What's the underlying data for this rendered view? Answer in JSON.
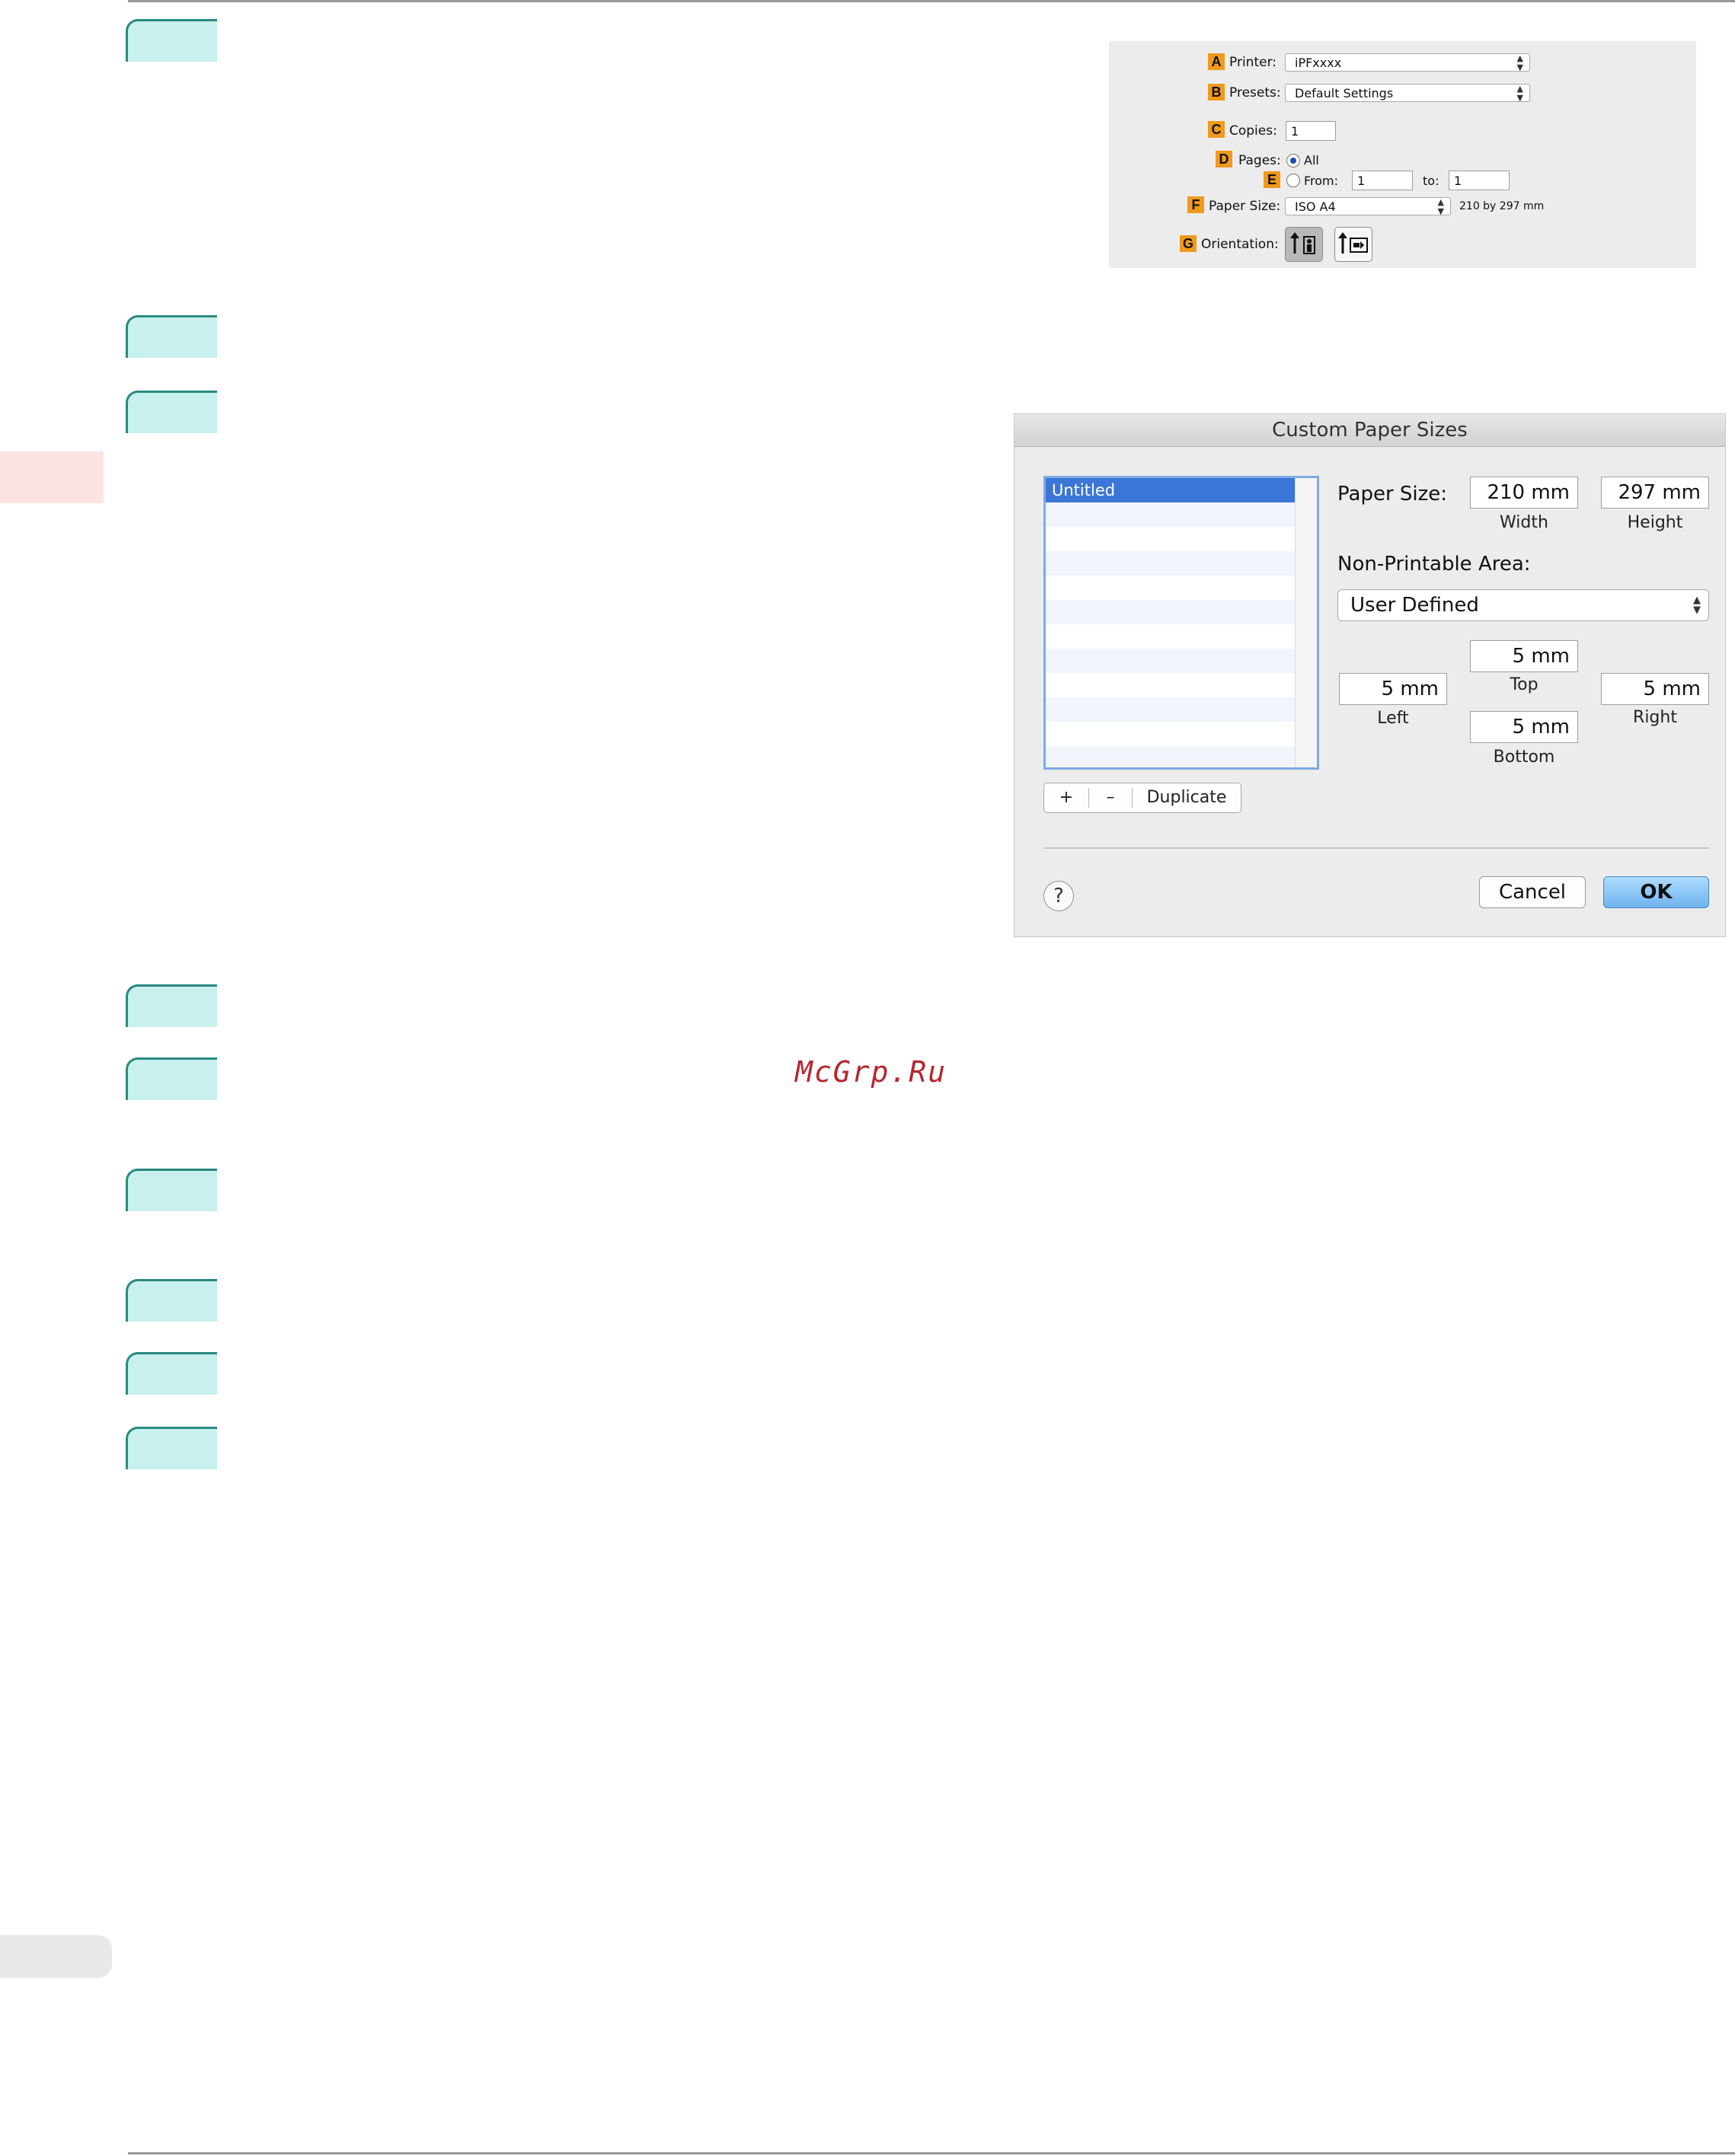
{
  "watermark": "McGrp.Ru",
  "print_dialog": {
    "printer": {
      "badge": "A",
      "label": "Printer:",
      "value": "iPFxxxx"
    },
    "presets": {
      "badge": "B",
      "label": "Presets:",
      "value": "Default Settings"
    },
    "copies": {
      "badge": "C",
      "label": "Copies:",
      "value": "1"
    },
    "pages": {
      "badge": "D",
      "label": "Pages:",
      "all_label": "All"
    },
    "range": {
      "badge": "E",
      "from_label": "From:",
      "from_value": "1",
      "to_label": "to:",
      "to_value": "1"
    },
    "paper_size": {
      "badge": "F",
      "label": "Paper Size:",
      "value": "ISO A4",
      "dimensions": "210 by 297 mm"
    },
    "orientation": {
      "badge": "G",
      "label": "Orientation:"
    }
  },
  "custom_paper_sizes": {
    "title": "Custom Paper Sizes",
    "list_items": [
      "Untitled"
    ],
    "add_label": "+",
    "remove_label": "–",
    "duplicate_label": "Duplicate",
    "paper_size_label": "Paper Size:",
    "width_value": "210  mm",
    "width_label": "Width",
    "height_value": "297  mm",
    "height_label": "Height",
    "non_printable_label": "Non-Printable Area:",
    "non_printable_value": "User Defined",
    "top_value": "5  mm",
    "top_label": "Top",
    "left_value": "5  mm",
    "left_label": "Left",
    "right_value": "5  mm",
    "right_label": "Right",
    "bottom_value": "5  mm",
    "bottom_label": "Bottom",
    "help_label": "?",
    "cancel_label": "Cancel",
    "ok_label": "OK"
  }
}
